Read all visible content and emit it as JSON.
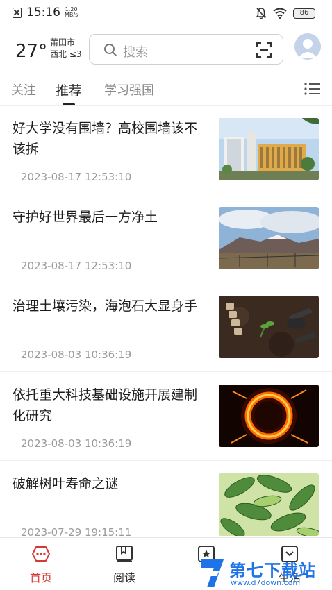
{
  "status_bar": {
    "time": "15:16",
    "speed_value": "1.20",
    "speed_unit": "MB/s",
    "battery": "86"
  },
  "header": {
    "temperature": "27°",
    "city": "莆田市",
    "wind": "西北 ≤3",
    "search_placeholder": "搜索"
  },
  "tabs": [
    {
      "label": "关注",
      "active": false
    },
    {
      "label": "推荐",
      "active": true
    },
    {
      "label": "学习强国",
      "active": false
    }
  ],
  "feed": [
    {
      "title": "好大学没有围墙？高校围墙该不该拆",
      "time": "2023-08-17 12:53:10",
      "image": "campus-buildings"
    },
    {
      "title": "守护好世界最后一方净土",
      "time": "2023-08-17 12:53:10",
      "image": "mountain-landscape"
    },
    {
      "title": "治理土壤污染，海泡石大显身手",
      "time": "2023-08-03 10:36:19",
      "image": "soil-seedlings"
    },
    {
      "title": "依托重大科技基础设施开展建制化研究",
      "time": "2023-08-03 10:36:19",
      "image": "fire-ring"
    },
    {
      "title": "破解树叶寿命之谜",
      "time": "2023-07-29 19:15:11",
      "image": "green-leaves"
    }
  ],
  "bottom_nav": [
    {
      "label": "首页",
      "icon": "home-icon",
      "active": true
    },
    {
      "label": "阅读",
      "icon": "book-icon",
      "active": false
    },
    {
      "label": "",
      "icon": "star-icon",
      "active": false
    },
    {
      "label": "生活",
      "icon": "life-icon",
      "active": false
    }
  ],
  "watermark": {
    "text": "第七下载站",
    "url": "www.d7down.com"
  },
  "colors": {
    "accent_red": "#d23a35",
    "watermark_blue": "#1e73e8"
  }
}
